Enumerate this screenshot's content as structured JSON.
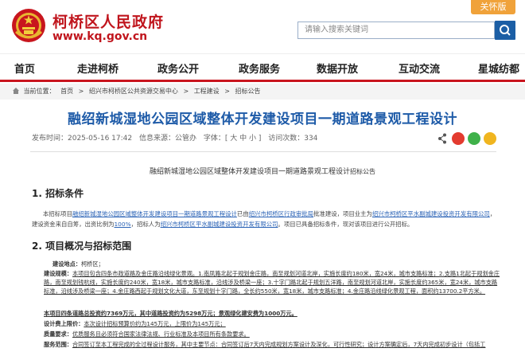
{
  "header": {
    "site_name": "柯桥区人民政府",
    "site_domain": "www.kq.gov.cn",
    "care_label": "关怀版",
    "search_placeholder": "请输入搜索关键词"
  },
  "nav": {
    "items": [
      "首页",
      "走进柯桥",
      "政务公开",
      "政务服务",
      "数据开放",
      "互动交流",
      "星城纺都"
    ]
  },
  "breadcrumb": {
    "prefix": "当前位置：",
    "items": [
      "首页",
      ">",
      "绍兴市柯桥区公共资源交易中心",
      ">",
      "工程建设",
      ">",
      "招标公告"
    ]
  },
  "article": {
    "title": "融绍新城湿地公园区域整体开发建设项目一期道路景观工程设计",
    "published": "发布时间：2025-05-16 17:42",
    "source": "信息来源：公管办",
    "font_label": "字体：[ 大 中 小 ]",
    "visits": "访问次数：334",
    "subtitle": "融绍新城湿地公园区域整体开发建设项目一期道路景观工程设计",
    "subtitle_suffix": "招标公告",
    "section1": "1. 招标条件",
    "section1_text_a": "本招标项目",
    "section1_link1": "融绍新城湿地公园区域整体开发建设项目一期道路景观工程设计",
    "section1_text_b": "已由",
    "section1_link2": "绍兴市柯桥区行政审批局",
    "section1_text_c": "批准建设，项目业主为",
    "section1_link3": "绍兴市柯桥区平水副城建设投资开发有限公司",
    "section1_text_d": "，建设资金来自自筹，出资比例为",
    "section1_link4": "100%",
    "section1_text_e": "，招标人为",
    "section1_link5": "绍兴市柯桥区平水副城建设投资开发有限公司",
    "section1_text_f": "。项目已具备招标条件，现对该项目进行公开招标。",
    "section2": "2. 项目概况与招标范围",
    "loc_label": "建设地点：",
    "loc_value": "柯桥区；",
    "scale_label": "建设规模：",
    "scale_text": "本项目包含四条市政道路及金庄路沿线绿化景观。1.南凤路北起于规划金庄路，南至规划河道北岸，实施长度约180米，宽24米，城市支路标准；2.支路1北起于规划金庄路，南至规划钱杭线，实施长度约240米，宽18米，城市支路标准，沿线涉及桥梁一座；3.十字门路北起于规划五洋路，南至规划河道北岸，实施长度约365米，宽24米，城市支路标准，沿线涉及桥梁一座；4.金庄路西起于规划文化大道，东至规划十字门路，全长约550米，宽18米，城市支路标准；4.金庄路沿线绿化景观工程，面积约13700.2平方米。",
    "invest_text": "本项目四条道路总投资约7369万元，其中道路投资约为5298万元；景观绿化建安费为1000万元。",
    "budget_label": "设计费上限价：",
    "budget_text": "本次设计招标预算价约为145万元，上限价为145万元；",
    "quality_label": "质量要求：",
    "quality_text": "优质服务且必须符合国家法律法规、行业标准及本项目所有条款要求。",
    "service_label": "服务范围：",
    "service_text": "合同签订至本工程完成的全过程设计服务，其中主要节点：合同签订后7天内完成规划方案设计及深化，可行性研究；设计方案确定后，7天内完成初步设计（包括工"
  },
  "colors": {
    "brand_red": "#c0151d",
    "title_blue": "#1e5ba8",
    "search_blue": "#1b5ea5",
    "care_orange": "#f0a23a"
  },
  "icons": [
    "national-emblem-icon",
    "search-icon",
    "home-icon",
    "share-icon",
    "weibo-icon",
    "wechat-icon",
    "favorite-icon"
  ]
}
